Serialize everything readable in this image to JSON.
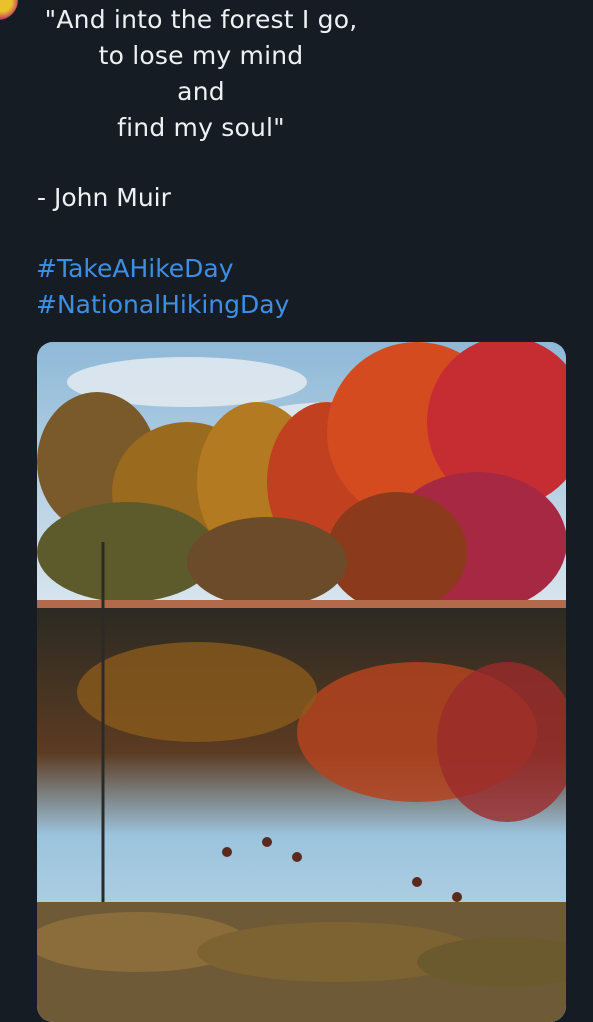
{
  "post": {
    "quote_lines": [
      "\"And into the forest I go,",
      "to lose my mind",
      "and",
      "find my soul\""
    ],
    "author": "- John Muir",
    "hashtags": [
      "#TakeAHikeDay",
      "#NationalHikingDay"
    ]
  },
  "media": {
    "description_icon": "photo-icon"
  },
  "colors": {
    "background": "#161c24",
    "text": "#eef1f4",
    "hashtag": "#3d8fe6"
  }
}
